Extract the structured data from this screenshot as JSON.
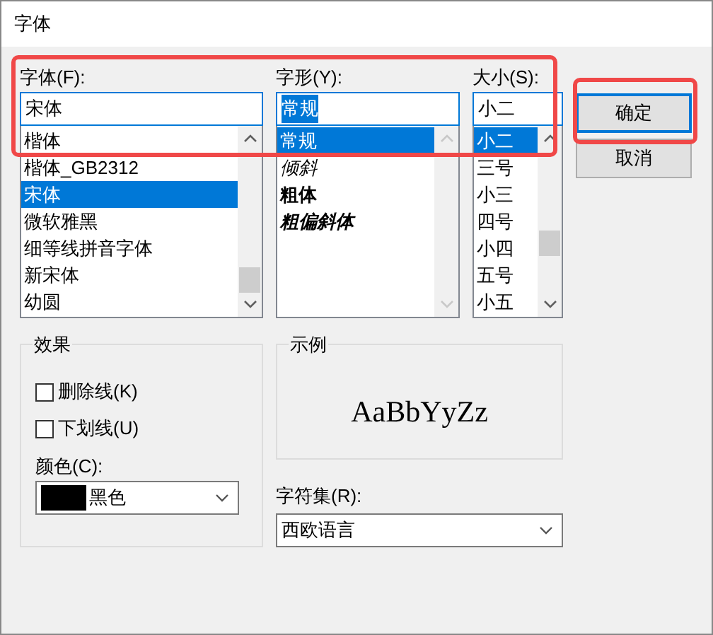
{
  "window": {
    "title": "字体"
  },
  "font": {
    "label": "字体(F):",
    "value": "宋体",
    "items": [
      {
        "text": "楷体",
        "selected": false
      },
      {
        "text": "楷体_GB2312",
        "selected": false
      },
      {
        "text": "宋体",
        "selected": true
      },
      {
        "text": "微软雅黑",
        "selected": false
      },
      {
        "text": "细等线拼音字体",
        "selected": false
      },
      {
        "text": "新宋体",
        "selected": false
      },
      {
        "text": "幼圆",
        "selected": false
      }
    ]
  },
  "style": {
    "label": "字形(Y):",
    "value": "常规",
    "items": [
      {
        "text": "常规",
        "kind": "regular",
        "selected": true
      },
      {
        "text": "倾斜",
        "kind": "italic",
        "selected": false
      },
      {
        "text": "粗体",
        "kind": "bold",
        "selected": false
      },
      {
        "text": "粗偏斜体",
        "kind": "bold-italic",
        "selected": false
      }
    ]
  },
  "size": {
    "label": "大小(S):",
    "value": "小二",
    "items": [
      {
        "text": "小二",
        "selected": true
      },
      {
        "text": "三号",
        "selected": false
      },
      {
        "text": "小三",
        "selected": false
      },
      {
        "text": "四号",
        "selected": false
      },
      {
        "text": "小四",
        "selected": false
      },
      {
        "text": "五号",
        "selected": false
      },
      {
        "text": "小五",
        "selected": false
      }
    ]
  },
  "buttons": [
    {
      "label": "确定",
      "kind": "default"
    },
    {
      "label": "取消",
      "kind": "normal"
    }
  ],
  "effects": {
    "title": "效果",
    "checkboxes": [
      {
        "label": "删除线(K)",
        "checked": false
      },
      {
        "label": "下划线(U)",
        "checked": false
      }
    ],
    "color_label": "颜色(C):",
    "color": {
      "value": "黑色",
      "color": "#000000"
    }
  },
  "sample": {
    "title": "示例",
    "text": "AaBbYyZz"
  },
  "charset": {
    "label": "字符集(R):",
    "value": "西欧语言"
  }
}
